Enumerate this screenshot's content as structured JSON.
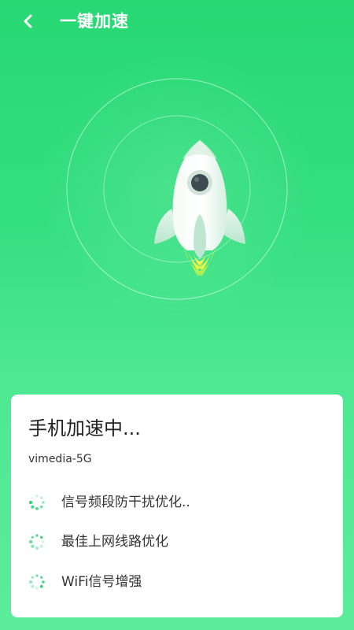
{
  "header": {
    "back_icon": "chevron-left-icon",
    "title": "一键加速"
  },
  "colors": {
    "background_top": "#27d873",
    "background_bottom": "#5cec9c",
    "rocket_body": "#eaf8ef",
    "rocket_window": "#3d4a4f",
    "flame_outer": "#b8f04a",
    "flame_inner": "#fff24a",
    "spinner": "#2fd47a"
  },
  "status_card": {
    "title": "手机加速中...",
    "network_name": "vimedia-5G",
    "tasks": [
      {
        "label": "信号频段防干扰优化..",
        "icon": "loading-spinner-icon"
      },
      {
        "label": "最佳上网线路优化",
        "icon": "loading-spinner-icon"
      },
      {
        "label": "WiFi信号增强",
        "icon": "loading-spinner-icon"
      }
    ]
  }
}
